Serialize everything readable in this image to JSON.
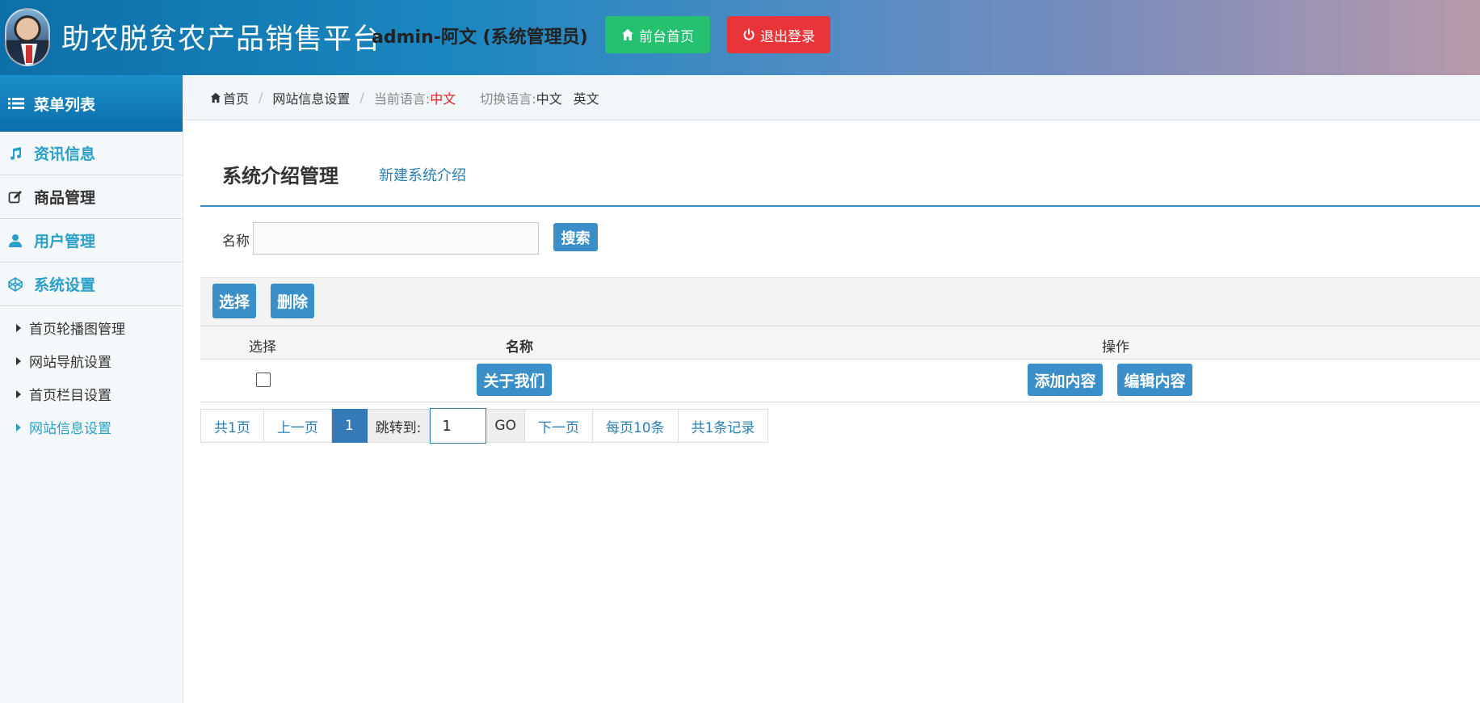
{
  "header": {
    "site_title": "助农脱贫农产品销售平台",
    "user_info": "admin-阿文 (系统管理员)",
    "home_button": "前台首页",
    "logout_button": "退出登录"
  },
  "sidebar": {
    "menu_title": "菜单列表",
    "items": [
      {
        "label": "资讯信息",
        "icon": "music-icon"
      },
      {
        "label": "商品管理",
        "icon": "edit-icon"
      },
      {
        "label": "用户管理",
        "icon": "user-icon"
      },
      {
        "label": "系统设置",
        "icon": "codepen-icon"
      }
    ],
    "subitems": [
      {
        "label": "首页轮播图管理"
      },
      {
        "label": "网站导航设置"
      },
      {
        "label": "首页栏目设置"
      },
      {
        "label": "网站信息设置",
        "active": true
      }
    ]
  },
  "breadcrumb": {
    "home": "首页",
    "current": "网站信息设置",
    "lang_label": "当前语言:",
    "lang_value": "中文",
    "switch_label": "切换语言:",
    "lang_zh": "中文",
    "lang_en": "英文"
  },
  "main": {
    "page_title": "系统介绍管理",
    "new_link": "新建系统介绍",
    "search_label": "名称",
    "search_value": "",
    "search_button": "搜索",
    "select_button": "选择",
    "delete_button": "删除",
    "table": {
      "headers": {
        "select": "选择",
        "name": "名称",
        "ops": "操作"
      },
      "rows": [
        {
          "name": "关于我们",
          "add": "添加内容",
          "edit": "编辑内容",
          "checked": false
        }
      ]
    },
    "pagination": {
      "total_pages": "共1页",
      "prev": "上一页",
      "current": "1",
      "jump_label": "跳转到:",
      "jump_value": "1",
      "go": "GO",
      "next": "下一页",
      "per_page": "每页10条",
      "total_records": "共1条记录"
    }
  },
  "colors": {
    "accent": "#3b8fc8",
    "home_button": "#25c16f",
    "logout_button": "#e8353a",
    "link": "#2b7fb5",
    "current_language": "#e02020"
  }
}
